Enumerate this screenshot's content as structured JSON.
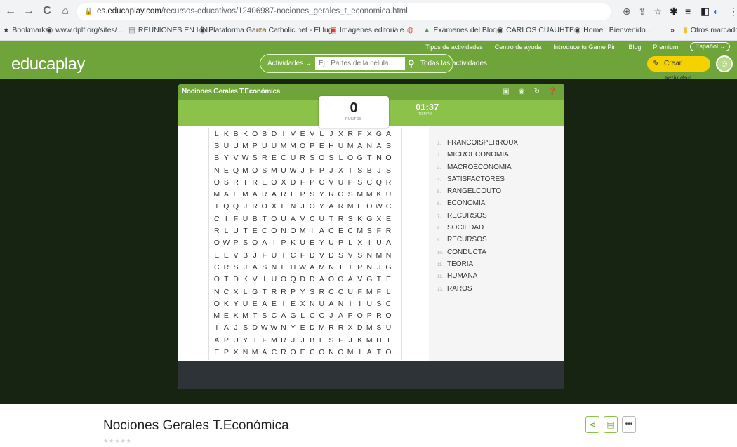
{
  "browser": {
    "nav": {
      "back": "←",
      "forward": "→",
      "reload": "C",
      "home": "⌂"
    },
    "url_host": "es.educaplay.com",
    "url_path": "/recursos-educativos/12406987-nociones_gerales_t_economica.html",
    "right_icons": [
      "⊕",
      "⇪",
      "☆",
      "✱",
      "≡",
      "◧",
      "◐",
      "⋮"
    ],
    "bookmarks": [
      {
        "label": "Bookmarks",
        "icon": "★"
      },
      {
        "label": "www.dplf.org/sites/...",
        "icon": "◉"
      },
      {
        "label": "REUNIONES EN LÍN...",
        "icon": "▤"
      },
      {
        "label": "Plataforma Garza",
        "icon": "◉"
      },
      {
        "label": "Catholic.net - El lug...",
        "icon": "cn"
      },
      {
        "label": "Imágenes editoriale...",
        "icon": "▣"
      },
      {
        "label": "",
        "icon": "◍"
      },
      {
        "label": "Exámenes del Bloq...",
        "icon": "▲"
      },
      {
        "label": "CARLOS CUAUHTE...",
        "icon": "◉"
      },
      {
        "label": "Home | Bienvenido...",
        "icon": "◉"
      }
    ],
    "bookmarks_more": "»",
    "other_bookmarks": "Otros marcadores"
  },
  "site": {
    "logo": "educaplay",
    "top_links": [
      "Tipos de actividades",
      "Centro de ayuda",
      "Introduce tu Game Pin",
      "Blog",
      "Premium"
    ],
    "language": "Español ⌄",
    "search": {
      "category": "Actividades ⌄",
      "placeholder": "Ej.: Partes de la célula...",
      "all_activities": "Todas las actividades"
    },
    "create_button": "Crear actividad"
  },
  "game": {
    "title": "Nociones Gerales T.Económica",
    "score": "0",
    "score_label": "PUNTOS",
    "timer": "01:37",
    "timer_label": "TIEMPO",
    "grid": [
      "LKBKOBDIVEVLJXRFXGA",
      "SUUMPUUMMOPEHUMANAS",
      "BYVWSRECURSOSLOGTNO",
      "NEQMOSMUWJFPJXISBJS",
      "OSRIREOXDFPCVUPSCQR",
      "MAEMARAREPSYROSMMKU",
      "IQQJROXENJOYARMEOWC",
      "CIFUBTOUAVCUTRSKGXE",
      "RLUTECONOMIACECMSFR",
      "OWPSQAIPKUEYUPLXIUA",
      "EEVBJFUTCFDVDSVSNMN",
      "CRSJASNEHWAMNITPNJG",
      "OTDKVIUOQDDAOOAVGTE",
      "NCXLGTRRPYSRCCUFMFL",
      "OKYUEAEIEXNUANIIUSC",
      "MEKMTSCAGLCCJAPOPRO",
      "IAJSDWWNYEDMRRXDMSU",
      "APUYTFMRJJBESFJKMHT",
      "EPXNMACROECONOMIATO"
    ],
    "words": [
      "FRANCOISPERROUX",
      "MICROECONOMIA",
      "MACROECONOMIA",
      "SATISFACTORES",
      "RANGELCOUTO",
      "ECONOMIA",
      "RECURSOS",
      "SOCIEDAD",
      "RECURSOS",
      "CONDUCTA",
      "TEORIA",
      "HUMANA",
      "RAROS"
    ]
  },
  "page": {
    "title": "Nociones Gerales T.Económica",
    "rating_stars": "★★★★★",
    "rating": 0
  }
}
